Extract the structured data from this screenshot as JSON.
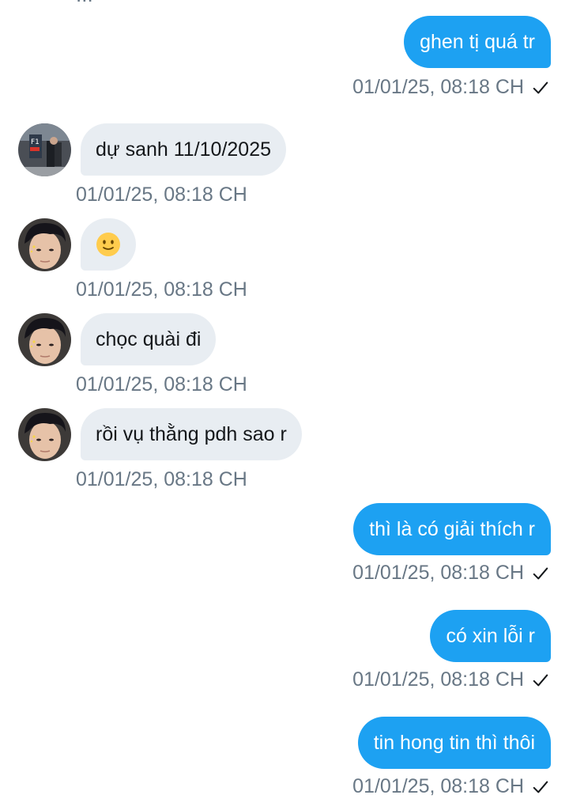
{
  "messages": [
    {
      "direction": "out",
      "text": "ghen tị quá tr",
      "time": "01/01/25, 08:18 CH",
      "status_icon": "check-icon"
    },
    {
      "direction": "in",
      "text": "dự sanh 11/10/2025",
      "time": "01/01/25, 08:18 CH",
      "avatar": "avatar-photo-store"
    },
    {
      "direction": "in",
      "text": "",
      "emoji": "slightly-smiling-face-emoji",
      "time": "01/01/25, 08:18 CH",
      "avatar": "avatar-portrait"
    },
    {
      "direction": "in",
      "text": "chọc quài đi",
      "time": "01/01/25, 08:18 CH",
      "avatar": "avatar-portrait"
    },
    {
      "direction": "in",
      "text": "rồi vụ thằng pdh sao r",
      "time": "01/01/25, 08:18 CH",
      "avatar": "avatar-portrait"
    },
    {
      "direction": "out",
      "text": "thì là có giải thích r",
      "time": "01/01/25, 08:18 CH",
      "status_icon": "check-icon"
    },
    {
      "direction": "out",
      "text": "có xin lỗi r",
      "time": "01/01/25, 08:18 CH",
      "status_icon": "check-icon"
    },
    {
      "direction": "out",
      "text": "tin hong tin thì thôi",
      "time": "01/01/25, 08:18 CH",
      "status_icon": "check-icon"
    }
  ],
  "colors": {
    "outgoing_bubble": "#1da1f2",
    "incoming_bubble": "#e8edf2",
    "timestamp": "#687785",
    "incoming_text": "#14171a",
    "outgoing_text": "#ffffff"
  }
}
